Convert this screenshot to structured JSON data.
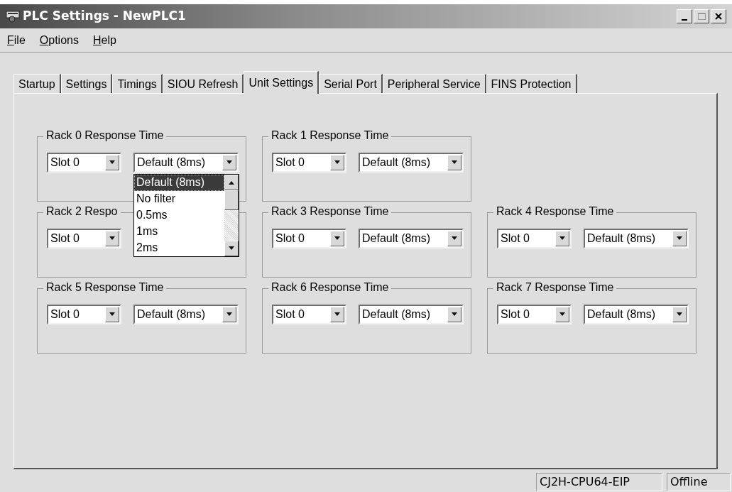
{
  "window": {
    "title": "PLC Settings - NewPLC1"
  },
  "menu": [
    {
      "label": "File"
    },
    {
      "label": "Options"
    },
    {
      "label": "Help"
    }
  ],
  "tabs": [
    {
      "label": "Startup",
      "selected": false
    },
    {
      "label": "Settings",
      "selected": false
    },
    {
      "label": "Timings",
      "selected": false
    },
    {
      "label": "SIOU Refresh",
      "selected": false
    },
    {
      "label": "Unit Settings",
      "selected": true
    },
    {
      "label": "Serial Port",
      "selected": false
    },
    {
      "label": "Peripheral Service",
      "selected": false
    },
    {
      "label": "FINS Protection",
      "selected": false
    }
  ],
  "rack_rows": [
    [
      {
        "title": "Rack 0 Response Time",
        "slot": "Slot 0",
        "response": "Default (8ms)",
        "dropdown": {
          "items": [
            {
              "label": "Default (8ms)",
              "selected": true
            },
            {
              "label": "No filter",
              "selected": false
            },
            {
              "label": "0.5ms",
              "selected": false
            },
            {
              "label": "1ms",
              "selected": false
            },
            {
              "label": "2ms",
              "selected": false
            }
          ]
        }
      },
      {
        "title": "Rack 1 Response Time",
        "slot": "Slot 0",
        "response": "Default (8ms)"
      }
    ],
    [
      {
        "title": "Rack 2 Respo",
        "slot": "Slot 0"
      },
      {
        "title": "Rack 3 Response Time",
        "slot": "Slot 0",
        "response": "Default (8ms)"
      },
      {
        "title": "Rack 4 Response Time",
        "slot": "Slot 0",
        "response": "Default (8ms)"
      }
    ],
    [
      {
        "title": "Rack 5 Response Time",
        "slot": "Slot 0",
        "response": "Default (8ms)"
      },
      {
        "title": "Rack 6 Response Time",
        "slot": "Slot 0",
        "response": "Default (8ms)"
      },
      {
        "title": "Rack 7 Response Time",
        "slot": "Slot 0",
        "response": "Default (8ms)"
      }
    ]
  ],
  "status_bar": {
    "model": "CJ2H-CPU64-EIP",
    "status": "Offline"
  }
}
